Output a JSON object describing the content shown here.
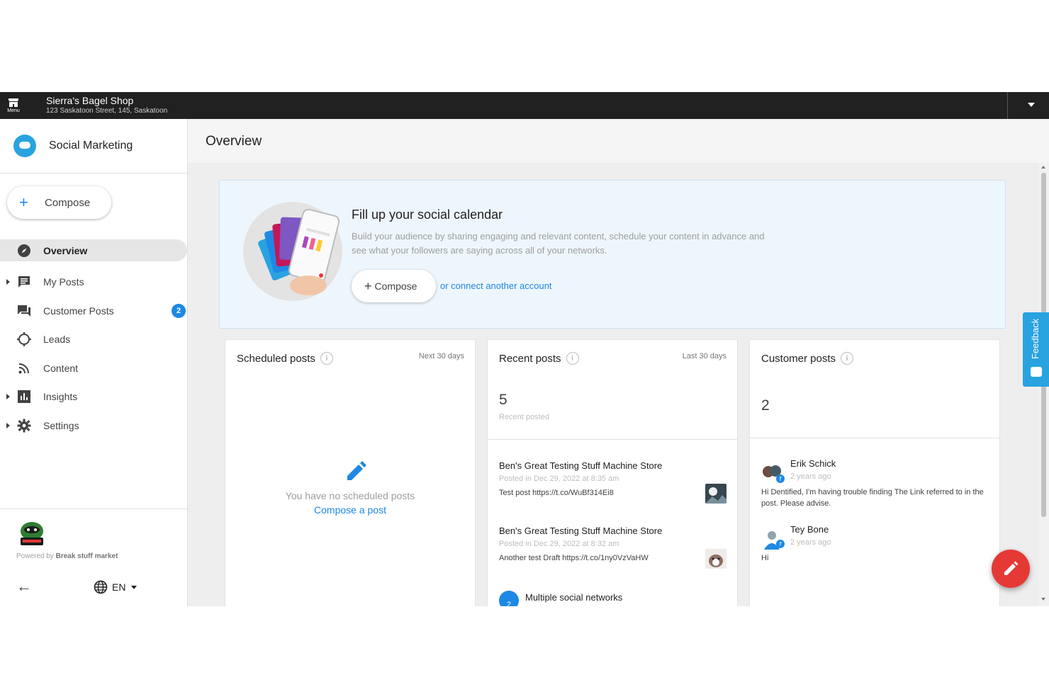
{
  "topbar": {
    "menu_label": "Menu",
    "business_name": "Sierra's Bagel Shop",
    "business_address": "123 Saskatoon Street, 145, Saskatoon"
  },
  "sidebar": {
    "brand": "Social Marketing",
    "compose_label": "Compose",
    "items": [
      {
        "label": "Overview",
        "icon": "compass-icon",
        "active": true
      },
      {
        "label": "My Posts",
        "icon": "chat-icon"
      },
      {
        "label": "Customer Posts",
        "icon": "forum-icon",
        "badge": "2"
      },
      {
        "label": "Leads",
        "icon": "crosshair-icon"
      },
      {
        "label": "Content",
        "icon": "rss-icon"
      },
      {
        "label": "Insights",
        "icon": "bar-chart-icon"
      },
      {
        "label": "Settings",
        "icon": "gear-icon"
      }
    ],
    "powered_prefix": "Powered by",
    "powered_brand": "Break stuff market",
    "language": "EN"
  },
  "main": {
    "title": "Overview",
    "banner": {
      "title": "Fill up your social calendar",
      "description": "Build your audience by sharing engaging and relevant content, schedule your content in advance and see what your followers are saying across all of your networks.",
      "compose_label": "Compose",
      "connect_link": "or connect another account"
    },
    "scheduled": {
      "title": "Scheduled posts",
      "range": "Next 30 days",
      "empty_text": "You have no scheduled posts",
      "empty_link": "Compose a post"
    },
    "recent": {
      "title": "Recent posts",
      "range": "Last 30 days",
      "count": "5",
      "count_label": "Recent posted",
      "posts": [
        {
          "name": "Ben's Great Testing Stuff Machine Store",
          "date": "Posted in Dec 29, 2022 at 8:35 am",
          "text": "Test post https://t.co/WuBf314Ei8"
        },
        {
          "name": "Ben's Great Testing Stuff Machine Store",
          "date": "Posted in Dec 29, 2022 at 8:32 am",
          "text": "Another test Draft https://t.co/1ny0VzVaHW"
        }
      ],
      "multi_count": "2",
      "multi_label": "Multiple social networks"
    },
    "customer": {
      "title": "Customer posts",
      "count": "2",
      "posts": [
        {
          "name": "Erik Schick",
          "time": "2 years ago",
          "text": "Hi Dentified, I'm having trouble finding The Link referred to in the post. Please advise."
        },
        {
          "name": "Tey Bone",
          "time": "2 years ago",
          "text": "Hi"
        }
      ]
    },
    "feedback_label": "Feedback"
  },
  "colors": {
    "accent": "#1e88e5",
    "brand": "#29a3e0",
    "fab": "#e53935",
    "topbar": "#212121"
  }
}
